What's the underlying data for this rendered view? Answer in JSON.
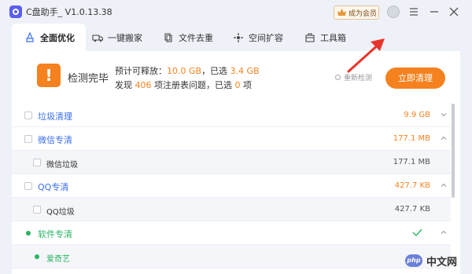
{
  "window": {
    "title": "C盘助手_ V1.0.13.38",
    "vip_label": "成为会员"
  },
  "tabs": [
    {
      "label": "全面优化",
      "icon": "broom-icon"
    },
    {
      "label": "一键搬家",
      "icon": "truck-icon"
    },
    {
      "label": "文件去重",
      "icon": "files-icon"
    },
    {
      "label": "空间扩容",
      "icon": "expand-icon"
    },
    {
      "label": "工具箱",
      "icon": "toolbox-icon"
    }
  ],
  "summary": {
    "status": "检测完毕",
    "line1_prefix": "预计可释放：",
    "release_size": "10.0 GB",
    "line1_mid": "，已选",
    "selected_size": "3.4 GB",
    "line2_prefix": "发现",
    "issue_count": "406",
    "line2_mid": "项注册表问题，已选",
    "selected_count": "0",
    "line2_suffix": "项",
    "recheck_label": "重新检测",
    "clean_button": "立即清理"
  },
  "list": {
    "rows": [
      {
        "type": "group",
        "name": "垃圾清理",
        "size": "9.9 GB",
        "expanded": false
      },
      {
        "type": "group",
        "name": "微信专清",
        "size": "177.1 MB",
        "expanded": true
      },
      {
        "type": "sub",
        "name": "微信垃圾",
        "size": "177.1 MB"
      },
      {
        "type": "group",
        "name": "QQ专清",
        "size": "427.7 KB",
        "expanded": true
      },
      {
        "type": "sub",
        "name": "QQ垃圾",
        "size": "427.7 KB"
      },
      {
        "type": "green-group",
        "name": "软件专清",
        "size": "",
        "expanded": true,
        "done": true
      },
      {
        "type": "green-sub",
        "name": "爱奇艺",
        "size": ""
      }
    ]
  },
  "watermark": {
    "logo": "php",
    "text": "中文网"
  },
  "colors": {
    "accent": "#f5821f",
    "link": "#3a6df0",
    "success": "#27b463"
  }
}
